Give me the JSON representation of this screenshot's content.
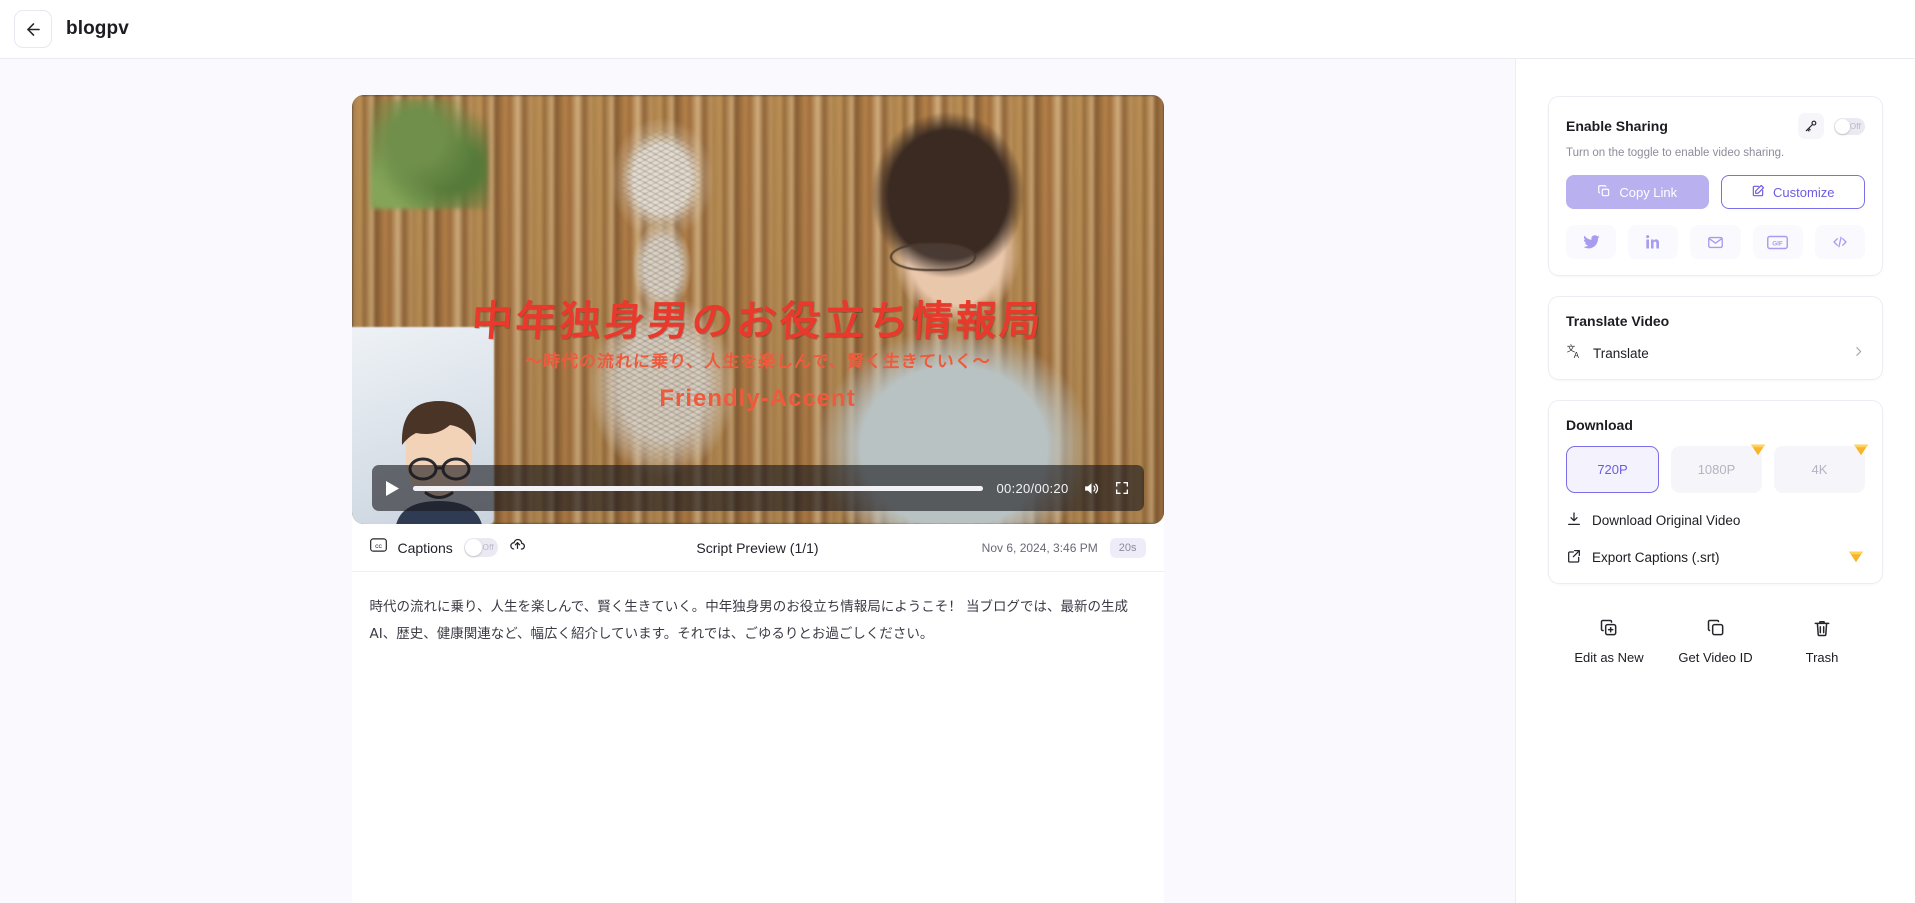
{
  "header": {
    "title": "blogpv",
    "back_icon": "arrow-left-icon"
  },
  "video": {
    "overlay_title": "中年独身男のお役立ち情報局",
    "overlay_subtitle": "〜時代の流れに乗り、人生を楽しんで、賢く生きていく〜",
    "overlay_brand": "Friendly-Accent",
    "time": "00:20/00:20",
    "play_icon": "play-icon",
    "volume_icon": "volume-icon",
    "fullscreen_icon": "fullscreen-icon",
    "progress_percent": 100
  },
  "caption_bar": {
    "cc_icon": "closed-caption-icon",
    "label": "Captions",
    "toggle_state": "Off",
    "upload_icon": "upload-cloud-icon",
    "script_preview": "Script Preview (1/1)",
    "date": "Nov 6, 2024, 3:46 PM",
    "duration_badge": "20s"
  },
  "script": {
    "text": "時代の流れに乗り、人生を楽しんで、賢く生きていく。中年独身男のお役立ち情報局にようこそ！ 当ブログでは、最新の生成AI、歴史、健康関連など、幅広く紹介しています。それでは、ごゆるりとお過ごしください。"
  },
  "sharing": {
    "title": "Enable Sharing",
    "key_icon": "key-icon",
    "toggle_state": "Off",
    "description": "Turn on the toggle to enable video sharing.",
    "copy_link_label": "Copy Link",
    "copy_icon": "copy-icon",
    "customize_label": "Customize",
    "customize_icon": "edit-square-icon",
    "socials": [
      {
        "name": "twitter-icon",
        "label": "Twitter"
      },
      {
        "name": "linkedin-icon",
        "label": "LinkedIn"
      },
      {
        "name": "email-icon",
        "label": "Email"
      },
      {
        "name": "gif-icon",
        "label": "GIF"
      },
      {
        "name": "embed-code-icon",
        "label": "Embed"
      }
    ]
  },
  "translate": {
    "title": "Translate Video",
    "item_label": "Translate",
    "item_icon": "translate-icon",
    "chevron_icon": "chevron-right-icon"
  },
  "download": {
    "title": "Download",
    "qualities": [
      {
        "label": "720P",
        "selected": true,
        "premium": false
      },
      {
        "label": "1080P",
        "selected": false,
        "premium": true
      },
      {
        "label": "4K",
        "selected": false,
        "premium": true
      }
    ],
    "original_label": "Download Original Video",
    "original_icon": "download-icon",
    "export_label": "Export Captions (.srt)",
    "export_icon": "external-link-icon",
    "export_premium": true
  },
  "actions": [
    {
      "label": "Edit as New",
      "icon": "copy-plus-icon"
    },
    {
      "label": "Get Video ID",
      "icon": "copy-icon"
    },
    {
      "label": "Trash",
      "icon": "trash-icon"
    }
  ],
  "colors": {
    "accent_purple": "#6c5ce0",
    "copy_link_bg": "#b9b0f0",
    "premium_gem": "#f9a825",
    "page_bg": "#faf9fd",
    "overlay_red": "#e8392c"
  }
}
